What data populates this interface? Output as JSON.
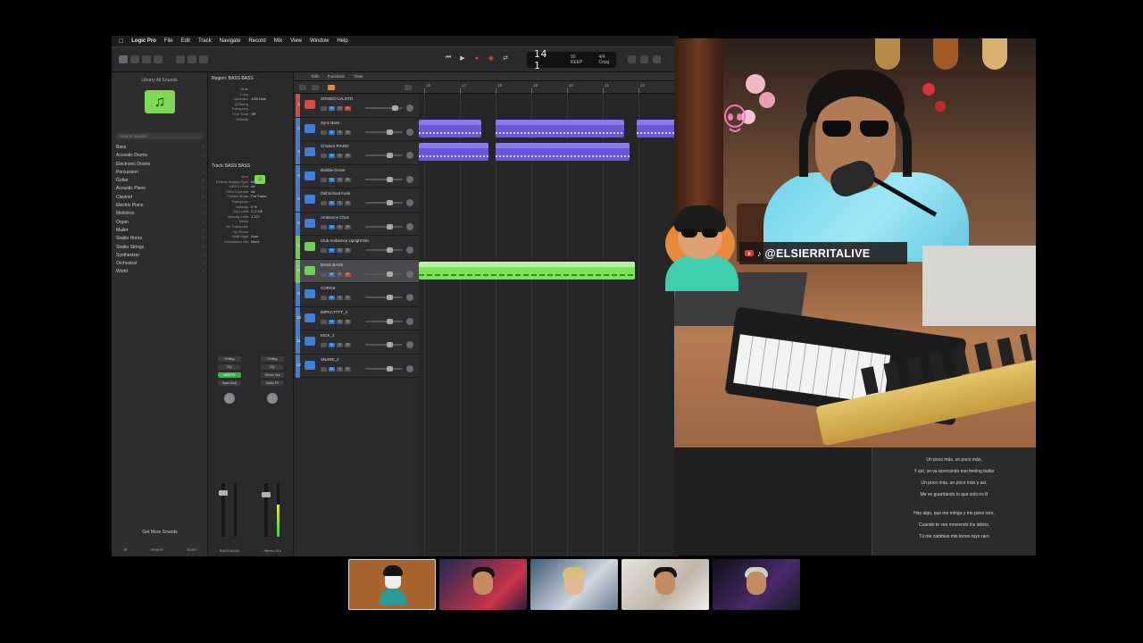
{
  "menubar": {
    "app_name": "Logic Pro",
    "items": [
      "File",
      "Edit",
      "Track",
      "Navigate",
      "Record",
      "Mix",
      "View",
      "Window",
      "?",
      "Help"
    ]
  },
  "transport": {
    "position": "14 1",
    "time_sig": "4/4",
    "key": "Cmaj",
    "tempo": "90",
    "tempo_label": "KEEP"
  },
  "library": {
    "header": "Library   All Sounds",
    "search_placeholder": "Search Sounds",
    "items": [
      "Bass",
      "Acoustic Drums",
      "Electronic Drums",
      "Percussion",
      "Guitar",
      "Acoustic Piano",
      "Clavinet",
      "Electric Piano",
      "Mellotron",
      "Organ",
      "Mallet",
      "Studio Horns",
      "Studio Strings",
      "Synthesizer",
      "Orchestral",
      "World"
    ],
    "more_sounds": "Get More Sounds",
    "revert": "Revert",
    "save": "Save"
  },
  "inspector": {
    "region_title": "Region: BASS BASS",
    "region_rows": [
      {
        "k": "Mute",
        "v": ""
      },
      {
        "k": "Loop",
        "v": ""
      },
      {
        "k": "Quantize",
        "v": "1/16 Note"
      },
      {
        "k": "Q-Swing",
        "v": ""
      },
      {
        "k": "Transpose",
        "v": ""
      },
      {
        "k": "Fine Tune",
        "v": "Off"
      },
      {
        "k": "Velocity",
        "v": ""
      }
    ],
    "track_title": "Track: BASS BASS",
    "track_rows": [
      {
        "k": "Icon",
        "v": ""
      },
      {
        "k": "Default Region Type",
        "v": "MIDI"
      },
      {
        "k": "MIDI In Port",
        "v": "All"
      },
      {
        "k": "MIDI Channel",
        "v": "All"
      },
      {
        "k": "Freeze Mode",
        "v": "Pre Fader"
      },
      {
        "k": "Transpose",
        "v": ""
      },
      {
        "k": "Velocity",
        "v": "0 %"
      },
      {
        "k": "Key Limit",
        "v": "C-2  G8"
      },
      {
        "k": "Velocity Limit",
        "v": "1  127"
      },
      {
        "k": "Delay",
        "v": ""
      },
      {
        "k": "No Transpose",
        "v": ""
      },
      {
        "k": "No Reset",
        "v": ""
      },
      {
        "k": "Staff Style",
        "v": "Auto"
      },
      {
        "k": "Articulation Set",
        "v": "None"
      }
    ],
    "strip_left": {
      "slots": [
        "Setting",
        "EQ",
        "MIDI FX",
        "Bass Amp"
      ],
      "name": "BASS BASS"
    },
    "strip_right": {
      "slots": [
        "Setting",
        "EQ",
        "Stereo Out",
        "Audio FX"
      ],
      "name": "Stereo Out"
    }
  },
  "tracks_bar": [
    "Edit",
    "Functions",
    "View"
  ],
  "ruler": [
    "16",
    "17",
    "18",
    "19",
    "20",
    "21",
    "22"
  ],
  "tracks": [
    {
      "num": "1",
      "name": "SONIDO LVLNTO",
      "color": "#d84a3f",
      "icon": "red"
    },
    {
      "num": "2",
      "name": "Sync Bass",
      "color": "#3f7fd8",
      "icon": "blue"
    },
    {
      "num": "3",
      "name": "Chicken PIANO",
      "color": "#3f7fd8",
      "icon": "blue"
    },
    {
      "num": "4",
      "name": "Bubble Drone",
      "color": "#3f7fd8",
      "icon": "blue"
    },
    {
      "num": "5",
      "name": "Old School Funk",
      "color": "#3f7fd8",
      "icon": "blue"
    },
    {
      "num": "6",
      "name": "Ambience Choir",
      "color": "#3f7fd8",
      "icon": "blue"
    },
    {
      "num": "7",
      "name": "Club Ambience Upright Mix",
      "color": "#6fcf57",
      "icon": "green"
    },
    {
      "num": "8",
      "name": "BASS BASS",
      "color": "#6fcf57",
      "icon": "green"
    },
    {
      "num": "9",
      "name": "COROS",
      "color": "#3f7fd8",
      "icon": "blue"
    },
    {
      "num": "10",
      "name": "IMPACTTTT_3",
      "color": "#3f7fd8",
      "icon": "blue"
    },
    {
      "num": "11",
      "name": "KICK_2",
      "color": "#3f7fd8",
      "icon": "blue"
    },
    {
      "num": "12",
      "name": "SNARE_2",
      "color": "#3f7fd8",
      "icon": "blue"
    }
  ],
  "regions": [
    {
      "name": "",
      "color": "blue"
    },
    {
      "name": "Sync Bass #64",
      "color": "blue"
    },
    {
      "name": "Sync Bass #64",
      "color": "blue"
    },
    {
      "name": "",
      "color": "blue"
    },
    {
      "name": "Chicken PIANO #64.2",
      "color": "blue"
    },
    {
      "name": "",
      "color": "green"
    }
  ],
  "overlay": {
    "handle": "@ELSIERRITALIVE",
    "tiktok_glyph": "♪"
  },
  "lyrics": [
    "Un poco más, un poco más,",
    "Y así, se va acercando ese feeling bailar",
    "Un poco más, un poco más y así,",
    "Me ve guardando lo que solo es B",
    "",
    "Hay algo, que me intriga y me pone raro,",
    "Cuando te veo moviendo los labios,",
    "Tú me cambias mis torres tuyo raro"
  ],
  "colors": {
    "accent_green": "#7ed957",
    "region_blue": "#6a58d8",
    "record_red": "#e0483e"
  }
}
